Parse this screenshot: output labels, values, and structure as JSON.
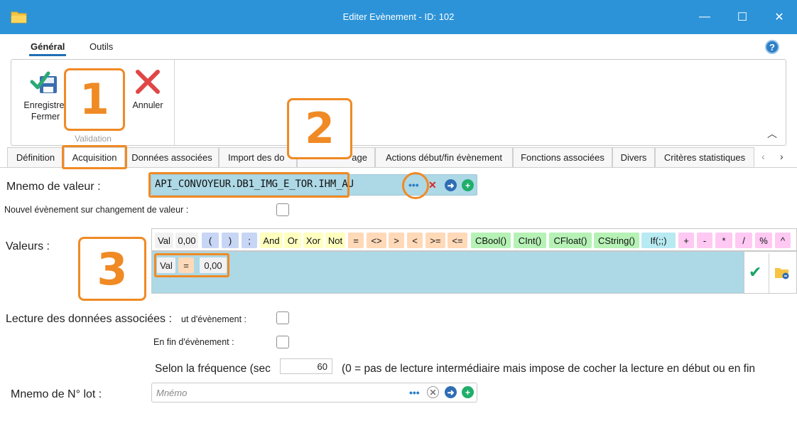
{
  "window": {
    "title": "Editer Evènement - ID: 102",
    "minimize": "—",
    "maximize": "☐",
    "close": "✕"
  },
  "ribbon": {
    "tabs": [
      "Général",
      "Outils"
    ],
    "help": "?",
    "buttons": {
      "save_line1": "Enregistrer",
      "save_line2": "Fermer",
      "cancel": "Annuler"
    },
    "group_label": "Validation",
    "collapse": "︿"
  },
  "callouts": [
    "1",
    "2",
    "3"
  ],
  "tabs": [
    "Définition",
    "Acquisition",
    "Données associées",
    "Import des do",
    "age",
    "Actions début/fin évènement",
    "Fonctions associées",
    "Divers",
    "Critères statistiques"
  ],
  "tab_nav": {
    "prev": "‹",
    "next": "›"
  },
  "form": {
    "mnemo_label": "Mnemo de valeur :",
    "mnemo_value": "API_CONVOYEUR.DB1_IMG_E_TOR.IHM_AU",
    "dots": "•••",
    "x": "✕",
    "arrow": "➜",
    "plus": "+",
    "new_event_label": "Nouvel évènement sur changement de valeur :",
    "values_label": "Valeurs :",
    "tokens": [
      "Val",
      "0,00",
      "(",
      ")",
      ";",
      "And",
      "Or",
      "Xor",
      "Not",
      "=",
      "<>",
      ">",
      "<",
      ">=",
      "<=",
      "CBool()",
      "CInt()",
      "CFloat()",
      "CString()",
      "If(;;)",
      "+",
      "-",
      "*",
      "/",
      "%",
      "^"
    ],
    "expression": [
      "Val",
      "=",
      "0,00"
    ],
    "read_label": "Lecture des données associées :",
    "start_label": "ut d'évènement :",
    "end_label": "En fin d'évènement :",
    "freq_label": "Selon la fréquence (sec",
    "freq_value": "60",
    "freq_note": "(0 = pas de lecture intermédiaire mais impose de cocher la lecture en début ou en fin",
    "lot_label": "Mnemo de N° lot :",
    "lot_placeholder": "Mnémo",
    "check": "✔"
  },
  "colors": {
    "titlebar": "#2c93d8",
    "callout": "#f08a24",
    "field_bg": "#add8e6"
  }
}
